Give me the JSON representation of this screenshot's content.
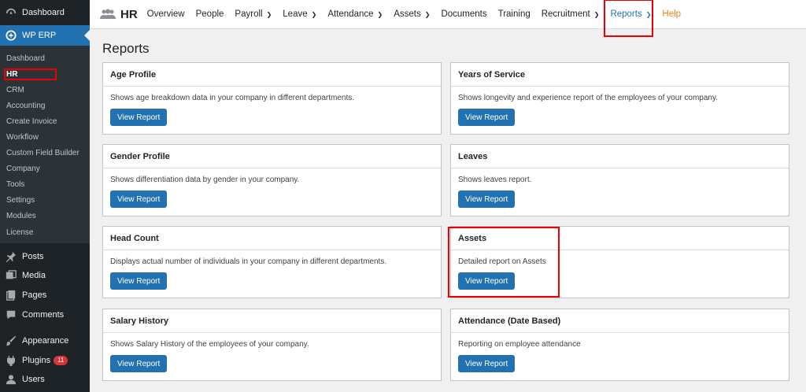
{
  "sidebar": {
    "dashboard": "Dashboard",
    "wp_erp": "WP ERP",
    "submenu": [
      "Dashboard",
      "HR",
      "CRM",
      "Accounting",
      "Create Invoice",
      "Workflow",
      "Custom Field Builder",
      "Company",
      "Tools",
      "Settings",
      "Modules",
      "License"
    ],
    "lower": [
      {
        "label": "Posts",
        "icon": "pin-icon"
      },
      {
        "label": "Media",
        "icon": "media-icon"
      },
      {
        "label": "Pages",
        "icon": "pages-icon"
      },
      {
        "label": "Comments",
        "icon": "comments-icon"
      },
      {
        "label": "Appearance",
        "icon": "paintbrush-icon"
      },
      {
        "label": "Plugins",
        "icon": "plugin-icon",
        "badge": "11"
      },
      {
        "label": "Users",
        "icon": "users-icon"
      }
    ]
  },
  "topnav": {
    "brand": "HR",
    "items": [
      "Overview",
      "People",
      "Payroll",
      "Leave",
      "Attendance",
      "Assets",
      "Documents",
      "Training",
      "Recruitment",
      "Reports",
      "Help"
    ],
    "active": "Reports"
  },
  "main": {
    "title": "Reports",
    "button_label": "View Report",
    "cards": [
      {
        "title": "Age Profile",
        "desc": "Shows age breakdown data in your company in different departments."
      },
      {
        "title": "Years of Service",
        "desc": "Shows longevity and experience report of the employees of your company."
      },
      {
        "title": "Gender Profile",
        "desc": "Shows differentiation data by gender in your company."
      },
      {
        "title": "Leaves",
        "desc": "Shows leaves report."
      },
      {
        "title": "Head Count",
        "desc": "Displays actual number of individuals in your company in different departments."
      },
      {
        "title": "Assets",
        "desc": "Detailed report on Assets"
      },
      {
        "title": "Salary History",
        "desc": "Shows Salary History of the employees of your company."
      },
      {
        "title": "Attendance (Date Based)",
        "desc": "Reporting on employee attendance"
      }
    ]
  },
  "colors": {
    "sidebar_bg": "#1d2327",
    "accent": "#2271b1",
    "highlight_box": "#e00000",
    "help": "#f0821e"
  }
}
